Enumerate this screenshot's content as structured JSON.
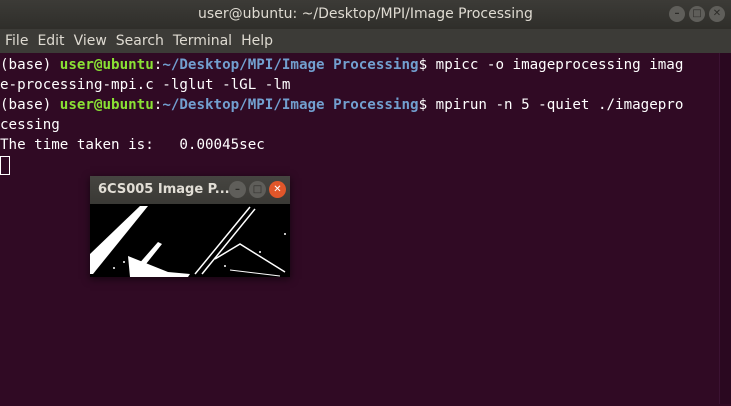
{
  "window": {
    "title": "user@ubuntu: ~/Desktop/MPI/Image Processing",
    "buttons": {
      "minimize": "–",
      "maximize": "□",
      "close": "✕"
    }
  },
  "menu": [
    "File",
    "Edit",
    "View",
    "Search",
    "Terminal",
    "Help"
  ],
  "terminal": {
    "prompt_env": "(base) ",
    "prompt_user": "user@ubuntu",
    "prompt_colon": ":",
    "prompt_path": "~/Desktop/MPI/Image Processing",
    "prompt_dollar": "$ ",
    "cmd1_part1": "mpicc -o imageprocessing imag",
    "cmd1_part2": "e-processing-mpi.c -lglut -lGL -lm",
    "cmd2_part1": "mpirun -n 5 -quiet ./imagepro",
    "cmd2_part2": "cessing",
    "output": "The time taken is:   0.00045sec"
  },
  "image_window": {
    "title": "6CS005 Image P...",
    "buttons": {
      "minimize": "–",
      "maximize": "□",
      "close": "✕"
    }
  },
  "colors": {
    "terminal_bg": "#300a24",
    "user": "#8ae234",
    "path": "#729fcf",
    "close_button": "#e0562a"
  }
}
